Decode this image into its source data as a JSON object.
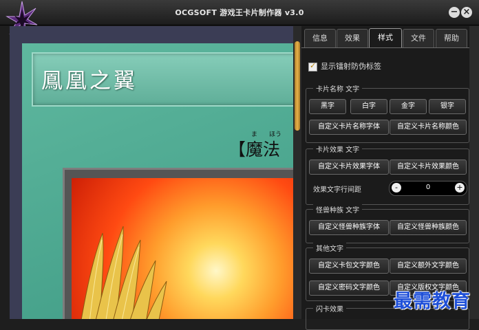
{
  "window": {
    "title": "OCGSOFT 游戏王卡片制作器 v3.0",
    "minimize_icon": "minus-circle-icon",
    "close_icon": "x-circle-icon"
  },
  "card": {
    "name": "鳳凰之翼",
    "type_bracket": "【魔法",
    "ruby_1": "ま",
    "ruby_2": "ほう"
  },
  "tabs": [
    {
      "label": "信息",
      "active": false
    },
    {
      "label": "效果",
      "active": false
    },
    {
      "label": "样式",
      "active": true
    },
    {
      "label": "文件",
      "active": false
    },
    {
      "label": "帮助",
      "active": false
    }
  ],
  "options": {
    "anti_counterfeit_label": "显示镭射防伪标签",
    "anti_counterfeit_checked": true
  },
  "groups": {
    "card_name": {
      "title": "卡片名称 文字",
      "black": "黑字",
      "white": "白字",
      "gold": "金字",
      "silver": "银字",
      "custom_font": "自定义卡片名称字体",
      "custom_color": "自定义卡片名称颜色"
    },
    "card_effect": {
      "title": "卡片效果 文字",
      "custom_font": "自定义卡片效果字体",
      "custom_color": "自定义卡片效果颜色",
      "line_spacing_label": "效果文字行间距",
      "line_spacing_value": "0",
      "minus": "-",
      "plus": "+"
    },
    "monster_race": {
      "title": "怪兽种族 文字",
      "custom_font": "自定义怪兽种族字体",
      "custom_color": "自定义怪兽种族颜色"
    },
    "other": {
      "title": "其他文字",
      "pack_color": "自定义卡包文字颜色",
      "extra_color": "自定义额外文字颜色",
      "password_color": "自定义密码文字颜色",
      "copyright_color": "自定义版权文字颜色"
    },
    "flash": {
      "title": "闪卡效果"
    }
  },
  "watermark": "最需教育",
  "colors": {
    "card_green": "#4fa98f",
    "accent_gold": "#d9a53a",
    "panel_bg": "#1b1b1b",
    "watermark_blue": "#1e4fd8"
  }
}
